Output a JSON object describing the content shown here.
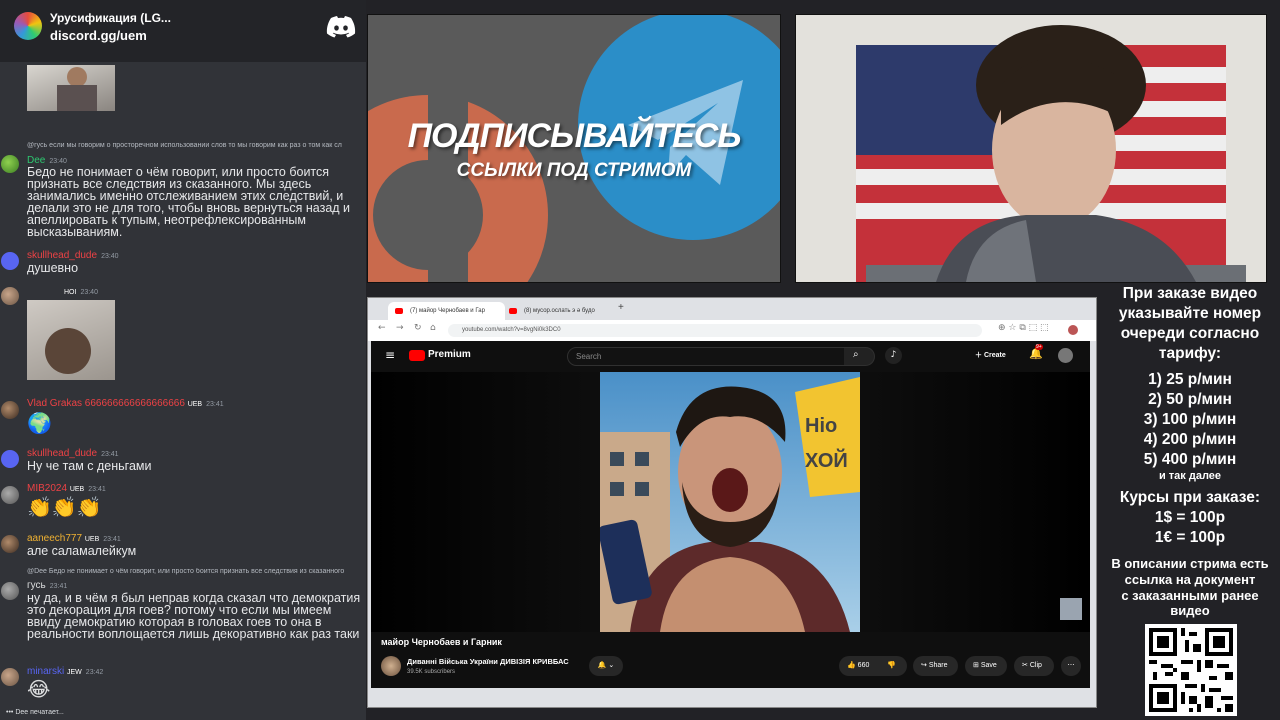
{
  "discord": {
    "server_name": "Урусификация (LG...",
    "invite": "discord.gg/uem",
    "typing": "Dee печатает..."
  },
  "messages": [
    {
      "reply": "@гусь если мы говорим о просторечном использовании слов то мы говорим как раз о том как сл",
      "name": "Dee",
      "name_color": "#2dc770",
      "time": "23:40",
      "text": "Бедо не понимает о чём говорит, или просто боится признать все следствия из сказанного. Мы здесь занимались именно отслеживанием этих следствий, и делали это не для того, чтобы вновь вернуться назад и апеллировать к тупым, неотрефлексированным высказываниям."
    },
    {
      "name": "skullhead_dude",
      "name_color": "#ed4245",
      "time": "23:40",
      "text": "душевно"
    },
    {
      "name": "",
      "badge": "HOI",
      "time": "23:40"
    },
    {
      "name": "Vlad Grakas 666666666666666666",
      "name_color": "#ed4245",
      "badge": "UEB",
      "time": "23:41",
      "emoji": "🌍"
    },
    {
      "name": "skullhead_dude",
      "name_color": "#ed4245",
      "time": "23:41",
      "text": "Ну че там с деньгами"
    },
    {
      "name": "MIB2024",
      "name_color": "#ed4245",
      "badge": "UEB",
      "time": "23:41",
      "emoji": "👏👏👏"
    },
    {
      "name": "aaneech777",
      "name_color": "#f0b232",
      "badge": "UEB",
      "time": "23:41",
      "text": "але саламалейкум"
    },
    {
      "reply": "@Dee Бедо не понимает о чём говорит, или просто боится признать все следствия из сказанного",
      "name": "гусь",
      "name_color": "#dcddde",
      "time": "23:41",
      "text": "ну да, и в чём я был неправ когда сказал что демократия это декорация для гоев? потому что если мы имеем ввиду демократию которая в головах гоев то она в реальности воплощается лишь декоративно как раз таки"
    },
    {
      "name": "minarski",
      "name_color": "#5865f2",
      "badge": "JEW",
      "time": "23:42",
      "emoji": "😂"
    }
  ],
  "promo": {
    "title": "ПОДПИСЫВАЙТЕСЬ",
    "subtitle": "ССЫЛКИ ПОД СТРИМОМ"
  },
  "browser": {
    "tabs": [
      "(7) майор Чернобаев и Гар",
      "(8) мусор.ослать э ә будо"
    ],
    "url": "youtube.com/watch?v=8vgNi0k3DC0"
  },
  "youtube": {
    "logo": "Premium",
    "search_placeholder": "Search",
    "create": "Create",
    "notifications": "9+",
    "video_title": "майор Чернобаев и Гарник",
    "channel": "Диванні Війська України ДИВІЗІЯ КРИВБАС",
    "subscribers": "39.5K subscribers",
    "likes": "660",
    "share": "Share",
    "save": "Save",
    "clip": "Clip"
  },
  "info": {
    "lines": [
      "При заказе видео",
      "указывайте номер",
      "очереди согласно",
      "тарифу:"
    ],
    "tariffs": [
      "1) 25 р/мин",
      "2) 50 р/мин",
      "3) 100 р/мин",
      "4) 200 р/мин",
      "5) 400 р/мин"
    ],
    "etc": "и так далее",
    "rates_title": "Курсы при заказе:",
    "rates": [
      "1$ = 100р",
      "1€ = 100р"
    ],
    "desc": [
      "В описании стрима есть",
      "ссылка на документ",
      "с заказанными ранее",
      "видео"
    ]
  }
}
